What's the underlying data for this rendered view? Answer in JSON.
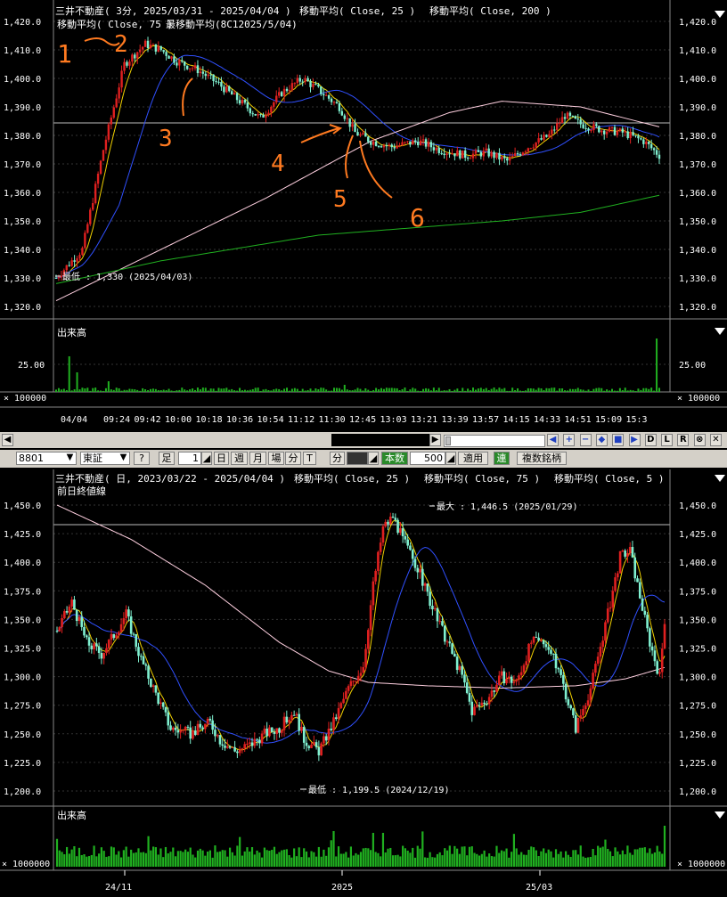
{
  "top_chart": {
    "title": "三井不動産( 3分, 2025/03/31 - 2025/04/04 )",
    "ma1_label": "移動平均( Close, 25 )",
    "ma2_label": "移動平均( Close, 200 )",
    "line2": "移動平均( Close, 75 )",
    "line3": "最移動平均(8C12025/5/04)",
    "y_ticks": [
      "1,420.0",
      "1,410.0",
      "1,400.0",
      "1,390.0",
      "1,380.0",
      "1,370.0",
      "1,360.0",
      "1,350.0",
      "1,340.0",
      "1,330.0",
      "1,320.0"
    ],
    "min_label": "最低 : 1,330 (2025/04/03)",
    "volume_title": "出来高",
    "volume_tick": "25.00",
    "volume_unit": "× 100000",
    "x_ticks": [
      "04/04",
      "09:24",
      "09:42",
      "10:00",
      "10:18",
      "10:36",
      "10:54",
      "11:12",
      "11:30",
      "12:45",
      "13:03",
      "13:21",
      "13:39",
      "13:57",
      "14:15",
      "14:33",
      "14:51",
      "15:09",
      "15:3"
    ],
    "handwritten": [
      "1",
      "2",
      "3",
      "4",
      "5",
      "6"
    ]
  },
  "scroll_buttons": [
    "◀",
    "+",
    "−",
    "◆",
    "■",
    "▶",
    "D",
    "L",
    "R",
    "⊗",
    "✕"
  ],
  "toolbar": {
    "code": "8801",
    "market": "東証",
    "help": "?",
    "ashi": "足",
    "period_value": "1",
    "day": "日",
    "week": "週",
    "month": "月",
    "place": "場",
    "minute_small": "分",
    "T": "T",
    "minute": "分",
    "count_label": "本数",
    "count_value": "500",
    "apply": "適用",
    "link": "連",
    "multi": "複数銘柄"
  },
  "bottom_chart": {
    "title": "三井不動産( 日, 2023/03/22 - 2025/04/04 )",
    "ma1_label": "移動平均( Close, 25 )",
    "ma2_label": "移動平均( Close, 75 )",
    "ma3_label": "移動平均( Close, 5 )",
    "line2": "前日終値線",
    "y_ticks": [
      "1,450.0",
      "1,425.0",
      "1,400.0",
      "1,375.0",
      "1,350.0",
      "1,325.0",
      "1,300.0",
      "1,275.0",
      "1,250.0",
      "1,225.0",
      "1,200.0"
    ],
    "max_label": "最大 : 1,446.5 (2025/01/29)",
    "min_label": "最低 : 1,199.5 (2024/12/19)",
    "volume_title": "出来高",
    "volume_unit": "× 1000000",
    "x_ticks": [
      "24/11",
      "2025",
      "25/03"
    ]
  },
  "colors": {
    "up": "#e02020",
    "down": "#7ff0d0",
    "ma_short": "#f0d000",
    "ma_mid": "#3050ff",
    "ma_long": "#ffd0e0",
    "ma_200": "#20b020",
    "annot": "#ff7a20",
    "grid": "#333"
  }
}
